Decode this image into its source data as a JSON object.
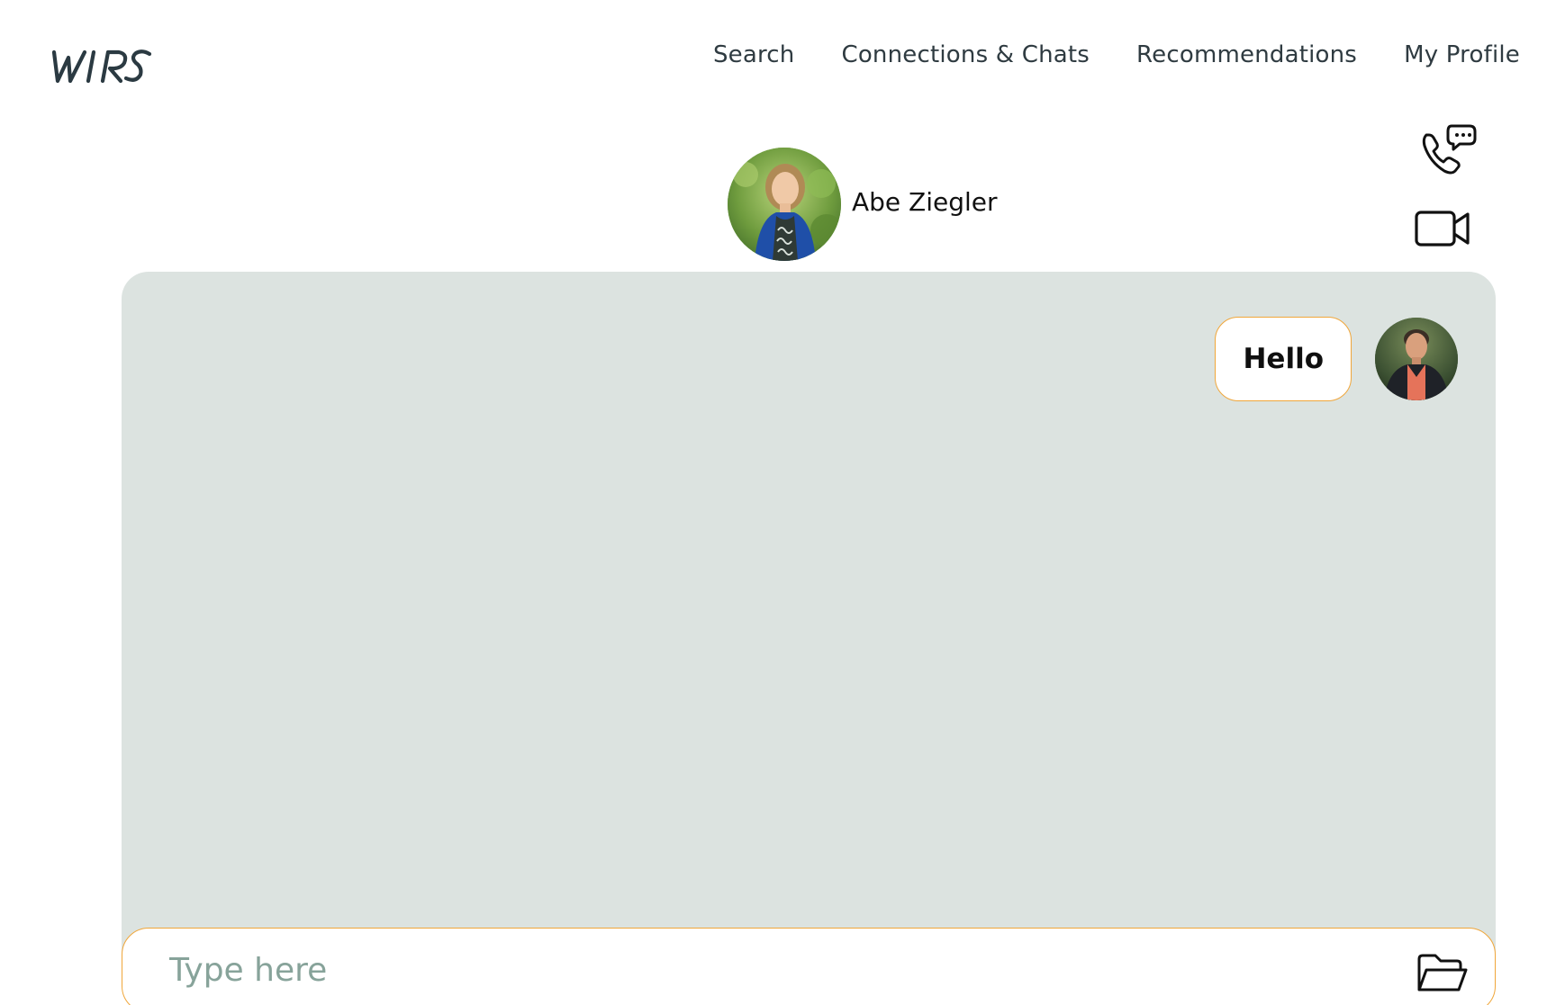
{
  "brand": {
    "logo_text": "WIRS"
  },
  "nav": {
    "items": [
      {
        "label": "Search"
      },
      {
        "label": "Connections & Chats"
      },
      {
        "label": "Recommendations"
      },
      {
        "label": "My Profile"
      }
    ]
  },
  "contact": {
    "name": "Abe Ziegler"
  },
  "icons": {
    "voice_call": "phone-chat-icon",
    "video_call": "video-camera-icon",
    "attach": "folder-icon"
  },
  "messages": [
    {
      "text": "Hello",
      "from": "me"
    }
  ],
  "composer": {
    "placeholder": "Type here",
    "value": ""
  },
  "colors": {
    "accent": "#f0a63a",
    "chat_background": "#dce3e0",
    "nav_text": "#2f3b41",
    "placeholder": "#87a39a"
  }
}
